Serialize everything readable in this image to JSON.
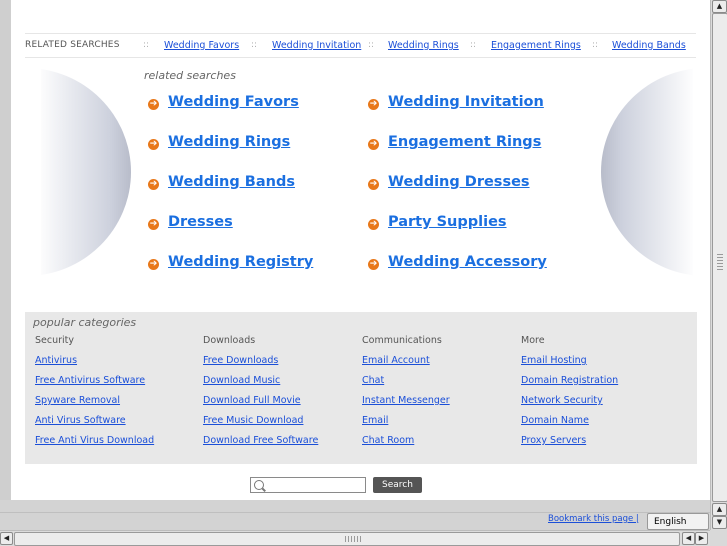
{
  "related_bar": {
    "title": "RELATED SEARCHES",
    "separator": "::",
    "links": [
      "Wedding Favors",
      "Wedding Invitation",
      "Wedding Rings",
      "Engagement Rings",
      "Wedding Bands"
    ]
  },
  "related_searches": {
    "heading": "related searches",
    "left": [
      "Wedding Favors",
      "Wedding Rings",
      "Wedding Bands",
      "Dresses",
      "Wedding Registry"
    ],
    "right": [
      "Wedding Invitation",
      "Engagement Rings",
      "Wedding Dresses",
      "Party Supplies",
      "Wedding Accessory"
    ]
  },
  "popular": {
    "title": "popular categories",
    "columns": [
      {
        "heading": "Security",
        "links": [
          "Antivirus",
          "Free Antivirus Software",
          "Spyware Removal",
          "Anti Virus Software",
          "Free Anti Virus Download"
        ]
      },
      {
        "heading": "Downloads",
        "links": [
          "Free Downloads",
          "Download Music",
          "Download Full Movie",
          "Free Music Download",
          "Download Free Software"
        ]
      },
      {
        "heading": "Communications",
        "links": [
          "Email Account",
          "Chat",
          "Instant Messenger",
          "Email",
          "Chat Room"
        ]
      },
      {
        "heading": "More",
        "links": [
          "Email Hosting",
          "Domain Registration",
          "Network Security",
          "Domain Name",
          "Proxy Servers"
        ]
      }
    ]
  },
  "search": {
    "placeholder": "",
    "button_label": "Search"
  },
  "footer": {
    "bookmark": "Bookmark this page |",
    "language": "English"
  },
  "icons": {
    "arrow": "arrow-circle-icon",
    "search": "magnifier-icon"
  },
  "colors": {
    "link": "#1b6fe0",
    "arrow": "#e8781a",
    "search_button": "#555555"
  }
}
